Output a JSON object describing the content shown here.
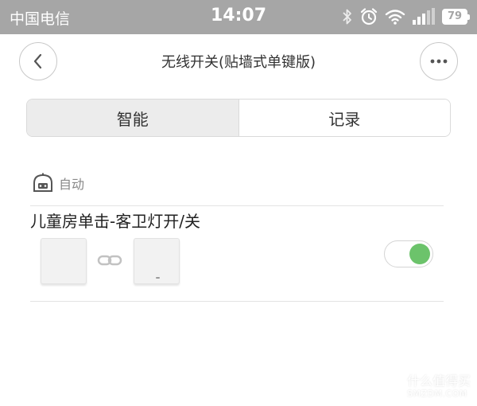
{
  "status_bar": {
    "carrier": "中国电信",
    "time": "14:07",
    "battery": "79",
    "icons": [
      "bluetooth-icon",
      "alarm-icon",
      "wifi-icon",
      "signal-icon",
      "battery-icon"
    ]
  },
  "nav": {
    "title": "无线开关(贴墙式单键版)",
    "back_icon": "chevron-left-icon",
    "more_icon": "more-icon"
  },
  "tabs": [
    {
      "label": "智能",
      "active": true
    },
    {
      "label": "记录",
      "active": false
    }
  ],
  "section": {
    "label": "自动",
    "icon": "robot-icon"
  },
  "rule": {
    "title": "儿童房单击-客卫灯开/关",
    "enabled": true,
    "link_icon": "link-icon"
  },
  "watermark": {
    "badge": "值",
    "text_cn": "什么值得买",
    "text_en": "SMZDM.COM"
  },
  "colors": {
    "status_bar_bg": "#a6a6a6",
    "toggle_on": "#6cc36b",
    "tab_active_bg": "#ececec"
  }
}
